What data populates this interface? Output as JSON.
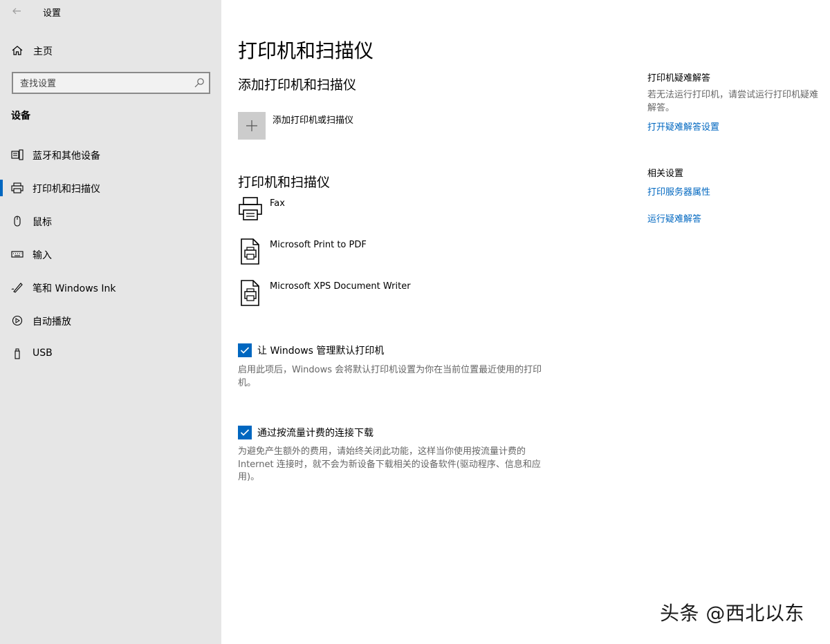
{
  "window": {
    "title": "设置",
    "controls": [
      "minimize-icon",
      "maximize-icon",
      "close-icon"
    ]
  },
  "sidebar": {
    "home_label": "主页",
    "search": {
      "placeholder": "查找设置"
    },
    "section_title": "设备",
    "items": [
      {
        "label": "蓝牙和其他设备",
        "icon": "bluetooth-devices-icon",
        "active": false
      },
      {
        "label": "打印机和扫描仪",
        "icon": "printer-icon",
        "active": true
      },
      {
        "label": "鼠标",
        "icon": "mouse-icon",
        "active": false
      },
      {
        "label": "输入",
        "icon": "keyboard-icon",
        "active": false
      },
      {
        "label": "笔和 Windows Ink",
        "icon": "pen-icon",
        "active": false
      },
      {
        "label": "自动播放",
        "icon": "autoplay-icon",
        "active": false
      },
      {
        "label": "USB",
        "icon": "usb-icon",
        "active": false
      }
    ]
  },
  "main": {
    "title": "打印机和扫描仪",
    "add_section": {
      "heading": "添加打印机和扫描仪",
      "add_label": "添加打印机或扫描仪"
    },
    "printers_section": {
      "heading": "打印机和扫描仪",
      "printers": [
        {
          "name": "Fax",
          "icon": "fax-printer-icon"
        },
        {
          "name": "Microsoft Print to PDF",
          "icon": "document-printer-icon"
        },
        {
          "name": "Microsoft XPS Document Writer",
          "icon": "document-printer-icon"
        }
      ]
    },
    "options": [
      {
        "label": "让 Windows 管理默认打印机",
        "checked": true,
        "description": "启用此项后，Windows 会将默认打印机设置为你在当前位置最近使用的打印机。"
      },
      {
        "label": "通过按流量计费的连接下载",
        "checked": true,
        "description": "为避免产生额外的费用，请始终关闭此功能，这样当你使用按流量计费的 Internet 连接时，就不会为新设备下载相关的设备软件(驱动程序、信息和应用)。"
      }
    ]
  },
  "right_column": {
    "troubleshoot": {
      "heading": "打印机疑难解答",
      "text": "若无法运行打印机，请尝试运行打印机疑难解答。",
      "link": "打开疑难解答设置"
    },
    "related": {
      "heading": "相关设置",
      "links": [
        "打印服务器属性",
        "运行疑难解答"
      ]
    }
  },
  "watermark": "头条 @西北以东",
  "colors": {
    "accent": "#0067c0",
    "sidebar_bg": "#e6e6e6",
    "tile_bg": "#cccccc",
    "secondary_text": "#666666"
  }
}
